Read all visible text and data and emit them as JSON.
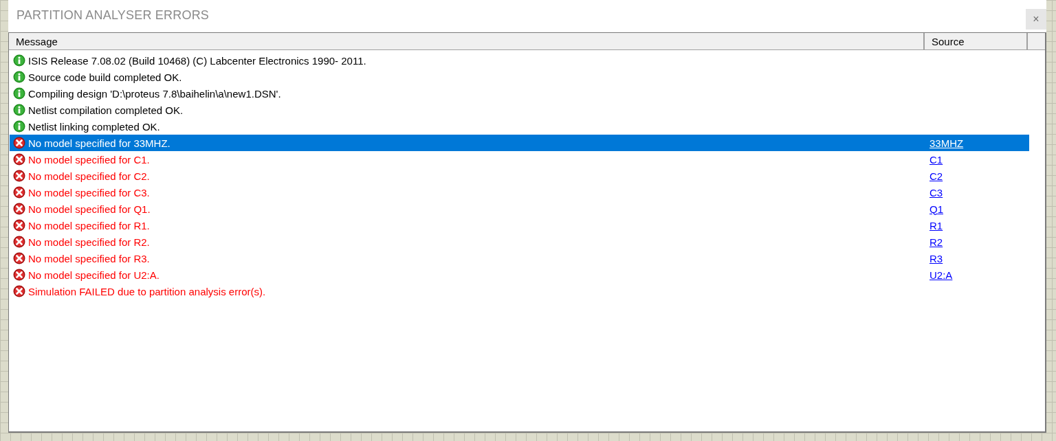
{
  "dialog": {
    "title": "PARTITION ANALYSER ERRORS",
    "close": "×"
  },
  "table": {
    "columns": [
      "Message",
      "Source"
    ],
    "rows": [
      {
        "kind": "info",
        "message": "ISIS Release 7.08.02 (Build 10468) (C) Labcenter Electronics 1990- 2011.",
        "selected": false
      },
      {
        "kind": "info",
        "message": "Source code build completed OK.",
        "selected": false
      },
      {
        "kind": "info",
        "message": "Compiling design 'D:\\proteus 7.8\\baihelin\\a\\new1.DSN'.",
        "selected": false
      },
      {
        "kind": "info",
        "message": "Netlist compilation completed OK.",
        "selected": false
      },
      {
        "kind": "info",
        "message": "Netlist linking completed OK.",
        "selected": false
      },
      {
        "kind": "error",
        "message": "No model specified for 33MHZ.",
        "source": "33MHZ",
        "selected": true
      },
      {
        "kind": "error",
        "message": "No model specified for C1.",
        "source": "C1",
        "selected": false
      },
      {
        "kind": "error",
        "message": "No model specified for C2.",
        "source": "C2",
        "selected": false
      },
      {
        "kind": "error",
        "message": "No model specified for C3.",
        "source": "C3",
        "selected": false
      },
      {
        "kind": "error",
        "message": "No model specified for Q1.",
        "source": "Q1",
        "selected": false
      },
      {
        "kind": "error",
        "message": "No model specified for R1.",
        "source": "R1",
        "selected": false
      },
      {
        "kind": "error",
        "message": "No model specified for R2.",
        "source": "R2",
        "selected": false
      },
      {
        "kind": "error",
        "message": "No model specified for R3.",
        "source": "R3",
        "selected": false
      },
      {
        "kind": "error",
        "message": "No model specified for U2:A.",
        "source": "U2:A",
        "selected": false
      },
      {
        "kind": "error",
        "message": "Simulation FAILED due to partition analysis error(s).",
        "selected": false
      }
    ]
  }
}
